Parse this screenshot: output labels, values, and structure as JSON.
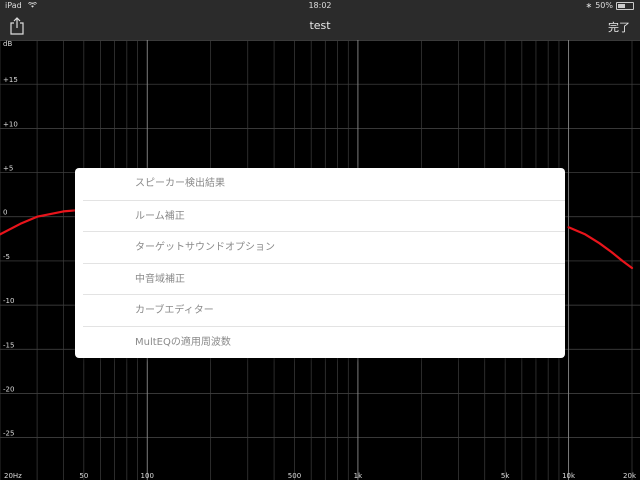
{
  "status_bar": {
    "device": "iPad",
    "time": "18:02",
    "battery": "50%",
    "battery_level": 0.5
  },
  "nav": {
    "title": "test",
    "done_label": "完了",
    "share_icon": "share-icon"
  },
  "chart_data": {
    "type": "line",
    "ylabel": "dB",
    "y_ticks": [
      "+15",
      "+10",
      "+5",
      "0",
      "-5",
      "-10",
      "-15",
      "-20",
      "-25"
    ],
    "y_tick_values": [
      15,
      10,
      5,
      0,
      -5,
      -10,
      -15,
      -20,
      -25
    ],
    "x_ticks": [
      "20Hz",
      "50",
      "100",
      "500",
      "1k",
      "5k",
      "10k",
      "20k"
    ],
    "x_tick_values": [
      20,
      50,
      100,
      500,
      1000,
      5000,
      10000,
      20000
    ],
    "x_scale": "log",
    "xlim": [
      20,
      20000
    ],
    "ylim": [
      -29,
      20
    ],
    "grid": true,
    "series": [
      {
        "color": "#e8141b",
        "x": [
          20,
          25,
          30,
          40,
          50,
          60
        ],
        "y": [
          -2,
          -0.8,
          0,
          0.6,
          0.8,
          0.9
        ]
      },
      {
        "color": "#e8141b",
        "x": [
          10000,
          12000,
          14000,
          16000,
          18000,
          20000
        ],
        "y": [
          -1.2,
          -2,
          -3,
          -4,
          -5,
          -5.8
        ]
      }
    ]
  },
  "menu": {
    "items": [
      "スピーカー検出結果",
      "ルーム補正",
      "ターゲットサウンドオプション",
      "中音域補正",
      "カーブエディター",
      "MultEQの適用周波数"
    ]
  }
}
